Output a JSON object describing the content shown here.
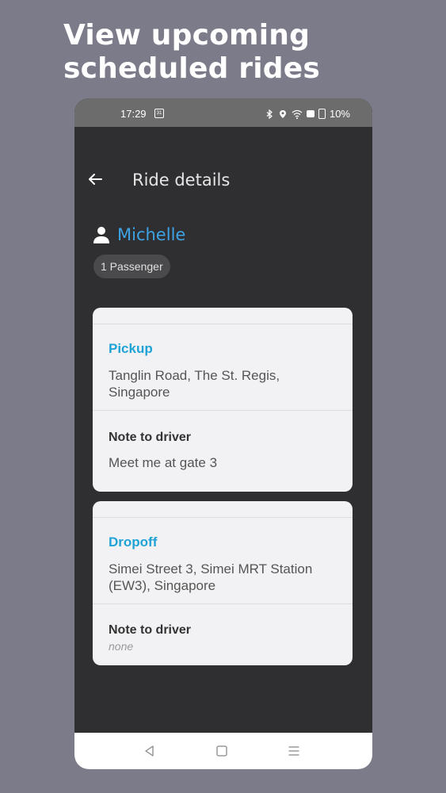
{
  "promo": {
    "headline_line1": "View upcoming",
    "headline_line2": "scheduled rides"
  },
  "status_bar": {
    "time": "17:29",
    "calendar_date": "31",
    "battery": "10%"
  },
  "app_bar": {
    "title": "Ride details"
  },
  "rider": {
    "name": "Michelle",
    "passengers": "1 Passenger"
  },
  "pickup": {
    "label": "Pickup",
    "address": "Tanglin Road, The St. Regis, Singapore",
    "note_label": "Note to driver",
    "note": "Meet me at gate 3"
  },
  "dropoff": {
    "label": "Dropoff",
    "address": "Simei Street 3, Simei MRT Station (EW3), Singapore",
    "note_label": "Note to driver",
    "note": "none"
  },
  "icons": {
    "back": "arrow-left-icon",
    "person": "person-icon",
    "nav_back": "triangle-back-icon",
    "nav_home": "square-home-icon",
    "nav_recents": "menu-recents-icon"
  },
  "colors": {
    "background": "#7b7b8a",
    "app_background": "#2f2f31",
    "accent_name": "#3da3e5",
    "accent_section": "#1fa3d6",
    "card": "#f2f2f4"
  }
}
